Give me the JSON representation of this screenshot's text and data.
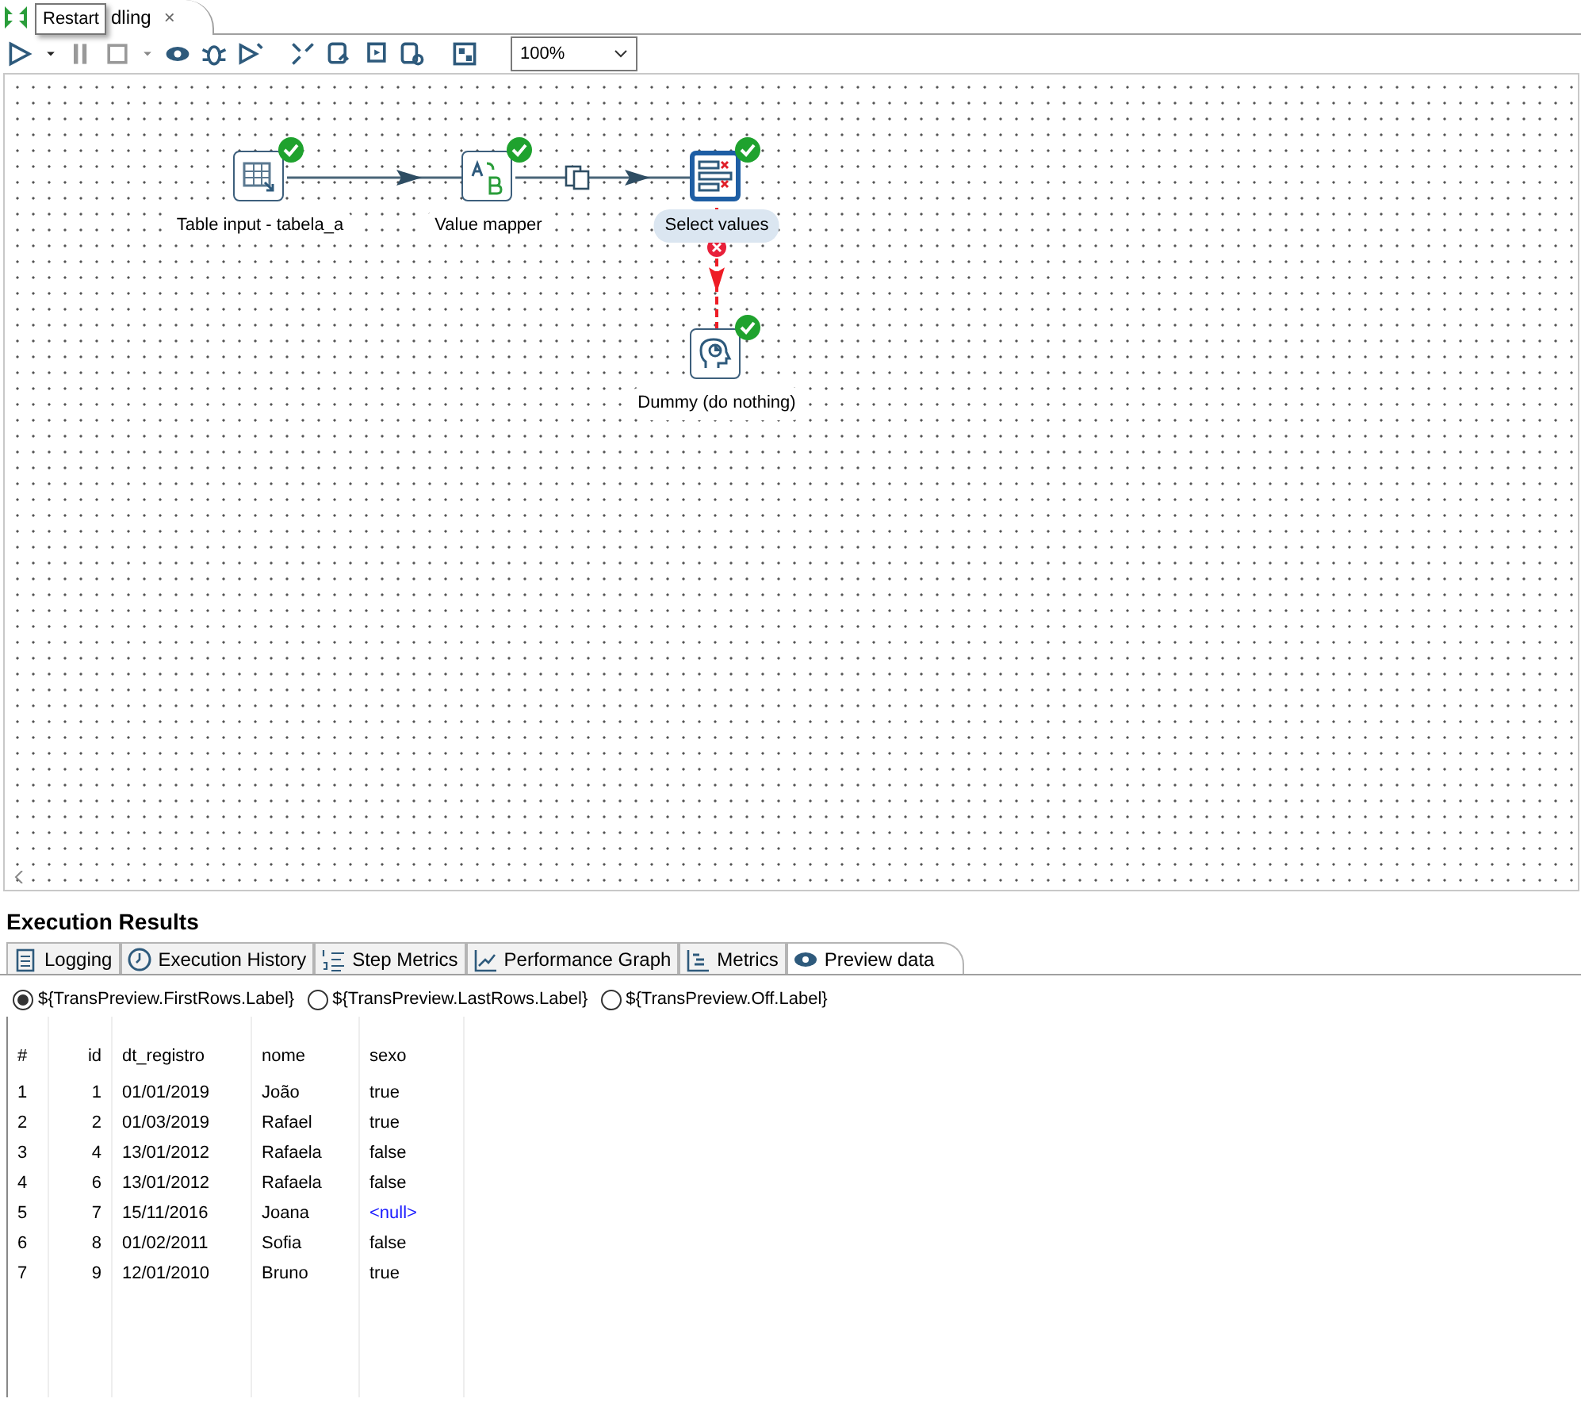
{
  "editor_tab": {
    "title": "dling",
    "close": "×"
  },
  "tooltip": {
    "text": "Restart"
  },
  "zoom": {
    "value": "100%"
  },
  "canvas": {
    "steps": [
      {
        "name": "Table input - tabela_a",
        "kind": "table_input",
        "ok": true,
        "selected": false
      },
      {
        "name": "Value mapper",
        "kind": "value_mapper",
        "ok": true,
        "selected": false
      },
      {
        "name": "Select values",
        "kind": "select_values",
        "ok": true,
        "selected": true
      },
      {
        "name": "Dummy (do nothing)",
        "kind": "dummy",
        "ok": true,
        "selected": false
      }
    ],
    "hops": [
      {
        "kind": "normal"
      },
      {
        "kind": "normal",
        "copy": true
      },
      {
        "kind": "error"
      }
    ]
  },
  "results": {
    "title": "Execution Results",
    "tabs": [
      {
        "label": "Logging",
        "kind": "logging",
        "selected": false
      },
      {
        "label": "Execution History",
        "kind": "history",
        "selected": false
      },
      {
        "label": "Step Metrics",
        "kind": "steps",
        "selected": false
      },
      {
        "label": "Performance Graph",
        "kind": "graph",
        "selected": false
      },
      {
        "label": "Metrics",
        "kind": "metrics",
        "selected": false
      },
      {
        "label": "Preview data",
        "kind": "preview",
        "selected": true
      }
    ],
    "options": [
      {
        "label": "${TransPreview.FirstRows.Label}",
        "selected": true
      },
      {
        "label": "${TransPreview.LastRows.Label}",
        "selected": false
      },
      {
        "label": "${TransPreview.Off.Label}",
        "selected": false
      }
    ],
    "table": {
      "columns": [
        "#",
        "id",
        "dt_registro",
        "nome",
        "sexo"
      ],
      "rows": [
        [
          "1",
          "1",
          "01/01/2019",
          "João",
          "true"
        ],
        [
          "2",
          "2",
          "01/03/2019",
          "Rafael",
          "true"
        ],
        [
          "3",
          "4",
          "13/01/2012",
          "Rafaela",
          "false"
        ],
        [
          "4",
          "6",
          "13/01/2012",
          "Rafaela",
          "false"
        ],
        [
          "5",
          "7",
          "15/11/2016",
          "Joana",
          {
            "text": "<null>",
            "null": true
          }
        ],
        [
          "6",
          "8",
          "01/02/2011",
          "Sofia",
          "false"
        ],
        [
          "7",
          "9",
          "12/01/2010",
          "Bruno",
          "true"
        ]
      ]
    }
  }
}
